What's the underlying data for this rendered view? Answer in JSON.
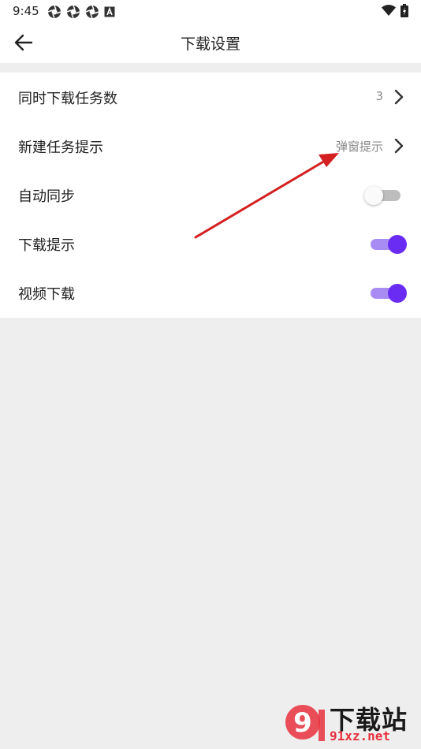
{
  "status_bar": {
    "time": "9:45",
    "left_icons": [
      "shutter-icon",
      "shutter-icon",
      "shutter-icon",
      "a-box-icon"
    ],
    "right_icons": [
      "wifi-icon",
      "battery-icon"
    ]
  },
  "app_bar": {
    "title": "下载设置",
    "back_icon": "arrow-left-icon"
  },
  "settings": {
    "items": [
      {
        "label": "同时下载任务数",
        "value": "3",
        "control": "chevron"
      },
      {
        "label": "新建任务提示",
        "value": "弹窗提示",
        "control": "chevron"
      },
      {
        "label": "自动同步",
        "control": "toggle",
        "checked": false
      },
      {
        "label": "下载提示",
        "control": "toggle",
        "checked": true
      },
      {
        "label": "视频下载",
        "control": "toggle",
        "checked": true
      }
    ]
  },
  "colors": {
    "accent": "#6a2cf2",
    "accent_track": "#a88cf4",
    "annotation_arrow": "#d42020",
    "background": "#eeeeee"
  },
  "watermark": {
    "badge": "9",
    "title": "下载站",
    "url": "91xz.net"
  }
}
